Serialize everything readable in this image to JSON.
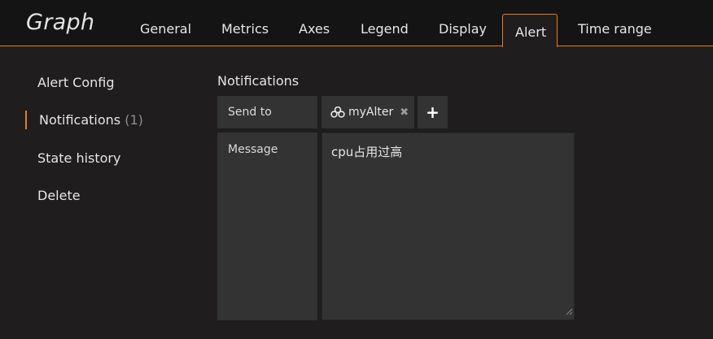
{
  "panel": {
    "title": "Graph"
  },
  "tabs": [
    {
      "label": "General"
    },
    {
      "label": "Metrics"
    },
    {
      "label": "Axes"
    },
    {
      "label": "Legend"
    },
    {
      "label": "Display"
    },
    {
      "label": "Alert",
      "active": true
    },
    {
      "label": "Time range"
    }
  ],
  "sidebar": {
    "items": [
      {
        "label": "Alert Config"
      },
      {
        "label": "Notifications",
        "count": "(1)",
        "active": true
      },
      {
        "label": "State history"
      },
      {
        "label": "Delete"
      }
    ]
  },
  "notifications": {
    "title": "Notifications",
    "send_to_label": "Send to",
    "recipient": {
      "name": "myAlter",
      "icon": "users-icon"
    },
    "add_label": "+",
    "message_label": "Message",
    "message_value": "cpu占用过高"
  },
  "colors": {
    "accent": "#eb7b18",
    "background": "#1f1d1d",
    "header": "#141414",
    "field": "#333333"
  }
}
